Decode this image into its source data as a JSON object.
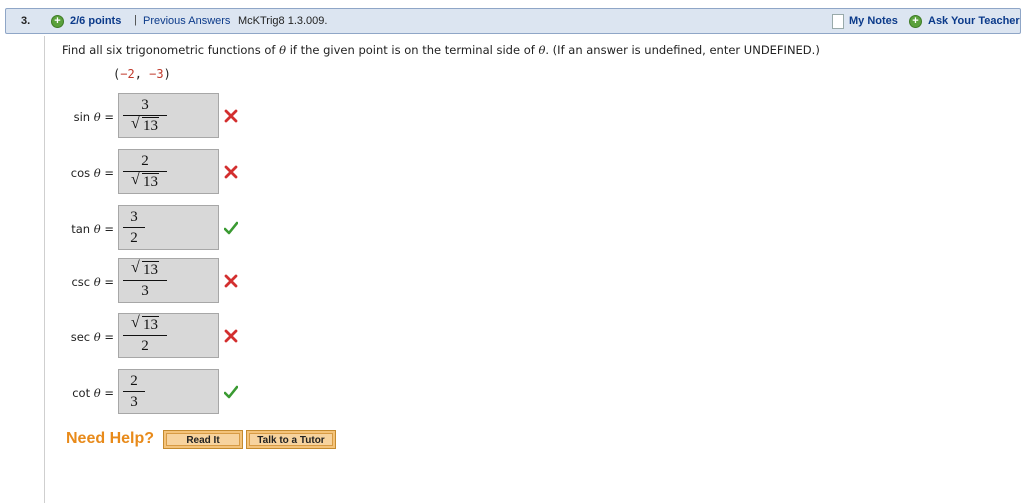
{
  "header": {
    "question_number": "3.",
    "points": "2/6 points",
    "separator": "|",
    "previous_answers": "Previous Answers",
    "problem_code": "McKTrig8 1.3.009.",
    "my_notes": "My Notes",
    "ask_teacher": "Ask Your Teacher"
  },
  "prompt": {
    "before": "Find all six trigonometric functions of ",
    "theta": "θ",
    "middle": " if the given point is on the terminal side of ",
    "after": ". (If an answer is undefined, enter UNDEFINED.)"
  },
  "point": {
    "open": "(",
    "x": "−2",
    "comma": ", ",
    "y": "−3",
    "close": ")"
  },
  "rows": [
    {
      "fn": "sin",
      "theta": "θ",
      "eq": "=",
      "num": "3",
      "den": "13",
      "radical": "den",
      "result": "incorrect"
    },
    {
      "fn": "cos",
      "theta": "θ",
      "eq": "=",
      "num": "2",
      "den": "13",
      "radical": "den",
      "result": "incorrect"
    },
    {
      "fn": "tan",
      "theta": "θ",
      "eq": "=",
      "num": "3",
      "den": "2",
      "radical": "none",
      "result": "correct"
    },
    {
      "fn": "csc",
      "theta": "θ",
      "eq": "=",
      "num": "13",
      "den": "3",
      "radical": "num",
      "result": "incorrect"
    },
    {
      "fn": "sec",
      "theta": "θ",
      "eq": "=",
      "num": "13",
      "den": "2",
      "radical": "num",
      "result": "incorrect"
    },
    {
      "fn": "cot",
      "theta": "θ",
      "eq": "=",
      "num": "2",
      "den": "3",
      "radical": "none",
      "result": "correct"
    }
  ],
  "help": {
    "label": "Need Help?",
    "read_it": "Read It",
    "talk_tutor": "Talk to a Tutor"
  },
  "colors": {
    "correct": "#3a9a32",
    "incorrect": "#d32f2f",
    "help": "#e88a1a",
    "link": "#0b3a8a"
  },
  "icons": {
    "add": "plus-circle-icon",
    "notes": "note-icon",
    "correct": "check-icon",
    "incorrect": "x-icon"
  }
}
